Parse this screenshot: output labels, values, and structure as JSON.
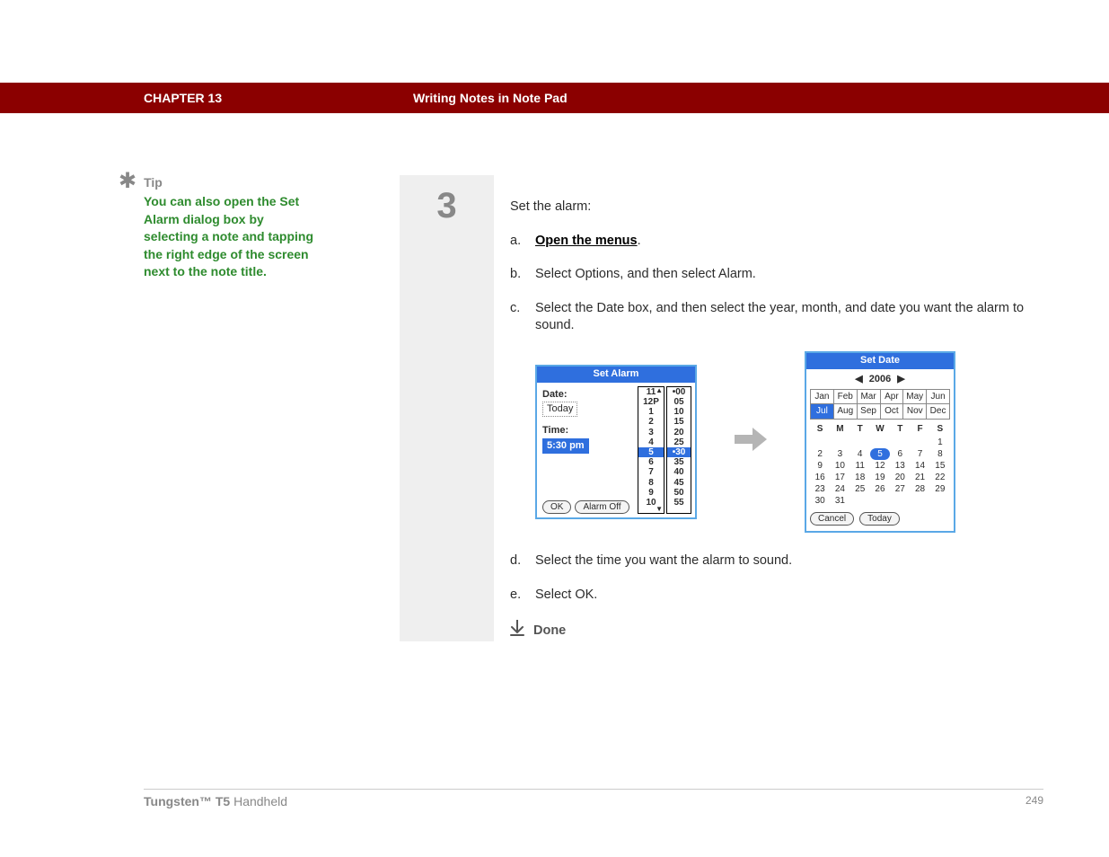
{
  "header": {
    "chapter_label": "CHAPTER 13",
    "chapter_title": "Writing Notes in Note Pad"
  },
  "tip": {
    "label": "Tip",
    "body": "You can also open the Set Alarm dialog box by selecting a note and tapping the right edge of the screen next to the note title."
  },
  "step": {
    "number": "3",
    "intro": "Set the alarm:",
    "items": [
      {
        "marker": "a.",
        "link_text": "Open the menus",
        "suffix": "."
      },
      {
        "marker": "b.",
        "text": "Select Options, and then select Alarm."
      },
      {
        "marker": "c.",
        "text": "Select the Date box, and then select the year, month, and date you want the alarm to sound."
      },
      {
        "marker": "d.",
        "text": "Select the time you want the alarm to sound."
      },
      {
        "marker": "e.",
        "text": "Select OK."
      }
    ],
    "done_label": "Done"
  },
  "set_alarm": {
    "title": "Set Alarm",
    "date_label": "Date:",
    "date_value": "Today",
    "time_label": "Time:",
    "time_value": "5:30 pm",
    "ok_label": "OK",
    "alarm_off_label": "Alarm Off",
    "hours": [
      "11",
      "12P",
      "1",
      "2",
      "3",
      "4",
      "5",
      "6",
      "7",
      "8",
      "9",
      "10"
    ],
    "hour_selected": "5",
    "minutes": [
      "00",
      "05",
      "10",
      "15",
      "20",
      "25",
      "30",
      "35",
      "40",
      "45",
      "50",
      "55"
    ],
    "minute_selected": "30",
    "minute_marks": [
      "00",
      "30"
    ]
  },
  "set_date": {
    "title": "Set Date",
    "year": "2006",
    "prev_glyph": "◀",
    "next_glyph": "▶",
    "months": [
      "Jan",
      "Feb",
      "Mar",
      "Apr",
      "May",
      "Jun",
      "Jul",
      "Aug",
      "Sep",
      "Oct",
      "Nov",
      "Dec"
    ],
    "month_selected": "Jul",
    "dow": [
      "S",
      "M",
      "T",
      "W",
      "T",
      "F",
      "S"
    ],
    "weeks": [
      [
        "",
        "",
        "",
        "",
        "",
        "",
        "1"
      ],
      [
        "2",
        "3",
        "4",
        "5",
        "6",
        "7",
        "8"
      ],
      [
        "9",
        "10",
        "11",
        "12",
        "13",
        "14",
        "15"
      ],
      [
        "16",
        "17",
        "18",
        "19",
        "20",
        "21",
        "22"
      ],
      [
        "23",
        "24",
        "25",
        "26",
        "27",
        "28",
        "29"
      ],
      [
        "30",
        "31",
        "",
        "",
        "",
        "",
        ""
      ]
    ],
    "day_selected": "5",
    "cancel_label": "Cancel",
    "today_label": "Today"
  },
  "footer": {
    "product_bold": "Tungsten™ T5",
    "product_rest": " Handheld",
    "page": "249"
  }
}
